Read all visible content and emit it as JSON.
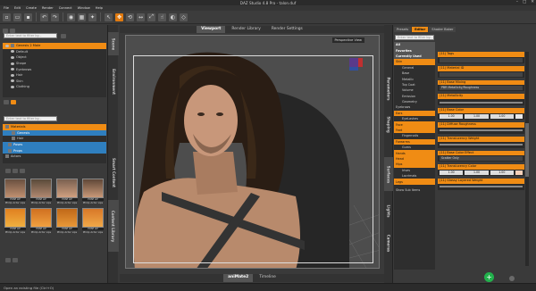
{
  "window": {
    "title": "DAZ Studio 4.8 Pro - talon.duf"
  },
  "menu": [
    "File",
    "Edit",
    "Create",
    "Render",
    "Connect",
    "Window",
    "Help"
  ],
  "left": {
    "vtabs": [
      "Scene",
      "Environment",
      "Smart Content",
      "Content Library"
    ],
    "scene_search": "Enter text to filter by...",
    "scene_items": [
      "Genesis 2 Male",
      "Default",
      "Object",
      "Shape",
      "Eyebrows",
      "Hair",
      "Skin",
      "Clothing"
    ],
    "content_search": "Enter text to filter by...",
    "content_tree": [
      "Materials",
      "Genesis",
      "Hair",
      "Poses",
      "Props",
      "Actors"
    ],
    "thumb_label": "POSE LIP",
    "thumbs": [
      "Philip Actor Lips",
      "Philip Actor Lips",
      "Philip Actor Lips",
      "Philip Actor Lips",
      "Philip Actor Lips",
      "Philip Actor Lips",
      "Philip Actor Lips",
      "Philip Actor Lips"
    ]
  },
  "center": {
    "tabs": [
      "Viewport",
      "Render Library",
      "Render Settings"
    ],
    "active_tab": "Viewport",
    "view_menu": "Perspective View",
    "bottom_tabs": [
      "aniMate2",
      "Timeline"
    ],
    "active_bottom": "aniMate2"
  },
  "right": {
    "vtabs": [
      "Parameters",
      "Shaping",
      "Surfaces",
      "Lights",
      "Cameras"
    ],
    "tabs": [
      "Presets",
      "Editor",
      "Shader Baker"
    ],
    "active_tab": "Editor",
    "filter": "Enter text to filter by...",
    "nav": [
      {
        "label": "All",
        "kind": "hdr"
      },
      {
        "label": "Favorites",
        "kind": "hdr"
      },
      {
        "label": "Currently Used",
        "kind": "hdr"
      },
      {
        "label": "Skin",
        "kind": "sel"
      },
      {
        "label": "General",
        "kind": "sub"
      },
      {
        "label": "Base",
        "kind": "sub"
      },
      {
        "label": "Metallic",
        "kind": "sub"
      },
      {
        "label": "Top Coat",
        "kind": "sub"
      },
      {
        "label": "Volume",
        "kind": "sub"
      },
      {
        "label": "Emission",
        "kind": "sub"
      },
      {
        "label": "Geometry",
        "kind": "sub"
      },
      {
        "label": "Eyebrows",
        "kind": "hdr"
      },
      {
        "label": "Ears",
        "kind": "sel"
      },
      {
        "label": "EyeLashes",
        "kind": "sub"
      },
      {
        "label": "Face",
        "kind": "sel"
      },
      {
        "label": "Feet",
        "kind": "sel"
      },
      {
        "label": "Fingernails",
        "kind": "sub"
      },
      {
        "label": "Forearms",
        "kind": "sel"
      },
      {
        "label": "Gums",
        "kind": "sub"
      },
      {
        "label": "Hands",
        "kind": "sel"
      },
      {
        "label": "Head",
        "kind": "sel"
      },
      {
        "label": "Hips",
        "kind": "sel"
      },
      {
        "label": "Irises",
        "kind": "sub"
      },
      {
        "label": "Lacrimals",
        "kind": "sub"
      },
      {
        "label": "Legs",
        "kind": "sel"
      }
    ],
    "props": [
      {
        "name": "(11) Tags",
        "kind": "drop",
        "value": ""
      },
      {
        "name": "(11) Material ID",
        "kind": "drop",
        "value": ""
      },
      {
        "name": "(11) Base Mixing",
        "kind": "drop",
        "value": "PBR Metallicity/Roughness"
      },
      {
        "name": "(11) Metallicity",
        "kind": "bar",
        "value": ""
      },
      {
        "name": "(11) Base Color",
        "kind": "color",
        "value": "1.00",
        "color": "#e8e8e8"
      },
      {
        "name": "(11) Diffuse Roughness",
        "kind": "bar",
        "value": ""
      },
      {
        "name": "(11) Translucency Weight",
        "kind": "bar",
        "value": ""
      },
      {
        "name": "(11) Base Color Effect",
        "kind": "drop",
        "value": "Scatter Only"
      },
      {
        "name": "(11) Translucency Color",
        "kind": "color",
        "value": "1.00",
        "color": "#f5d0b8"
      },
      {
        "name": "(11) Glossy Layered Weight",
        "kind": "bar",
        "value": ""
      }
    ],
    "show_sub": "Show Sub Items"
  },
  "status": "Open an existing file (Ctrl+O)",
  "colors": {
    "accent": "#f08c14",
    "blue": "#2f7fbf",
    "bg": "#3a3a3a"
  }
}
